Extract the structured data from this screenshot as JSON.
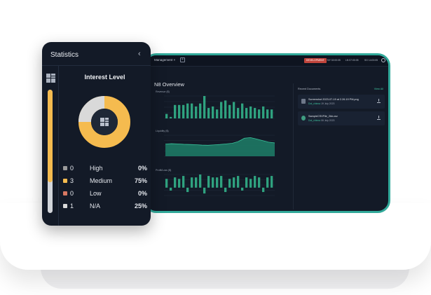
{
  "dashboard": {
    "topbar": {
      "tab_label": "Management",
      "tab_close": "×",
      "add_tab": "+",
      "environment_badge": "DEVELOPMENT",
      "clocks": [
        "NY 02:00:05",
        "LN 07:00:05",
        "SG 14:00:05"
      ]
    },
    "overview_title": "N8 Overview",
    "chart_labels": {
      "revenue": "Revenue ($)",
      "liquidity": "Liquidity ($)",
      "profit": "Profit/Loss ($)"
    },
    "recent_documents": {
      "title": "Recent Documents",
      "view_all": "View All",
      "items": [
        {
          "name": "Screenshot 2023-07-19 at 2.26.19 PM.png",
          "by": "Dot_chinna",
          "date": "19 July 2023"
        },
        {
          "name": "SampleCSVFile_2kb.csv",
          "by": "Dot_chinna",
          "date": "06 July 2023"
        }
      ]
    }
  },
  "stats": {
    "title": "Statistics",
    "collapse_icon": "‹",
    "interest_title": "Interest Level",
    "legend": [
      {
        "count": "0",
        "label": "High",
        "pct": "0%",
        "color": "#9a9a9a"
      },
      {
        "count": "3",
        "label": "Medium",
        "pct": "75%",
        "color": "#f5bb4f"
      },
      {
        "count": "0",
        "label": "Low",
        "pct": "0%",
        "color": "#d87862"
      },
      {
        "count": "1",
        "label": "N/A",
        "pct": "25%",
        "color": "#d9d9d9"
      }
    ],
    "slider_level": 0.75
  },
  "chart_data": [
    {
      "type": "bar",
      "name_key": "revenue",
      "values": [
        3,
        1,
        9,
        9,
        9,
        10,
        10,
        8,
        10,
        15,
        7,
        8,
        6,
        11,
        12,
        9,
        11,
        7,
        10,
        7,
        8,
        7,
        6,
        8,
        6,
        6
      ]
    },
    {
      "type": "area",
      "name_key": "liquidity",
      "values": [
        62,
        64,
        63,
        61,
        60,
        59,
        57,
        56,
        58,
        60,
        63,
        66,
        75,
        92,
        95,
        88,
        80,
        72,
        68
      ]
    },
    {
      "type": "bar",
      "name_key": "profit",
      "values": [
        6,
        -2,
        7,
        6,
        8,
        -3,
        7,
        7,
        9,
        -4,
        8,
        7,
        7,
        8,
        -3,
        6,
        7,
        8,
        -2,
        7,
        6,
        8,
        7,
        -3,
        7,
        8
      ]
    }
  ]
}
